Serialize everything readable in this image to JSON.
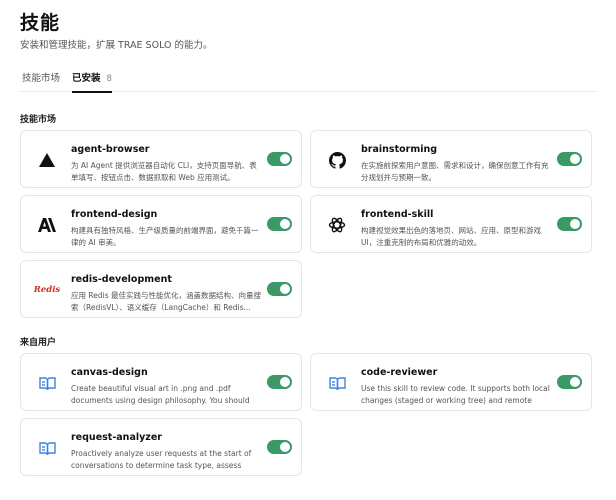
{
  "header": {
    "title": "技能",
    "subtitle": "安装和管理技能，扩展 TRAE SOLO 的能力。"
  },
  "tabs": [
    {
      "label": "技能市场",
      "active": false
    },
    {
      "label": "已安装",
      "count": "8",
      "active": true
    }
  ],
  "sections": [
    {
      "title": "技能市场",
      "skills": [
        {
          "name": "agent-browser",
          "description": "为 AI Agent 提供浏览器自动化 CLI，支持页面导航、表单填写、按钮点击、数据抓取和 Web 应用测试。",
          "icon": "triangle-icon",
          "enabled": true
        },
        {
          "name": "brainstorming",
          "description": "在实施前探索用户意图、需求和设计，确保创意工作有充分规划并与预期一致。",
          "icon": "github-icon",
          "enabled": true
        },
        {
          "name": "frontend-design",
          "description": "构建具有独特风格、生产级质量的前端界面，避免千篇一律的 AI 审美。",
          "icon": "anthropic-icon",
          "enabled": true
        },
        {
          "name": "frontend-skill",
          "description": "构建视觉效果出色的落地页、网站、应用、原型和游戏UI，注重克制的布局和优雅的动效。",
          "icon": "openai-icon",
          "enabled": true
        },
        {
          "name": "redis-development",
          "description": "应用 Redis 最佳实践与性能优化，涵盖数据结构、向量搜索（RedisVL）、语义缓存（LangCache）和 Redis...",
          "icon": "redis-logo-icon",
          "icon_text": "Redis",
          "enabled": true
        }
      ]
    },
    {
      "title": "来自用户",
      "skills": [
        {
          "name": "canvas-design",
          "description": "Create beautiful visual art in .png and .pdf documents using design philosophy. You should use this skill...",
          "icon": "book-icon",
          "enabled": true
        },
        {
          "name": "code-reviewer",
          "description": "Use this skill to review code. It supports both local changes (staged or working tree) and remote Pull...",
          "icon": "book-icon",
          "enabled": true
        },
        {
          "name": "request-analyzer",
          "description": "Proactively analyze user requests at the start of conversations to determine task type, assess promp...",
          "icon": "book-icon",
          "enabled": true
        }
      ]
    }
  ],
  "colors": {
    "toggle_on": "#3a9a65",
    "user_skill_icon": "#3b82e6",
    "redis_logo": "#d82c20"
  }
}
